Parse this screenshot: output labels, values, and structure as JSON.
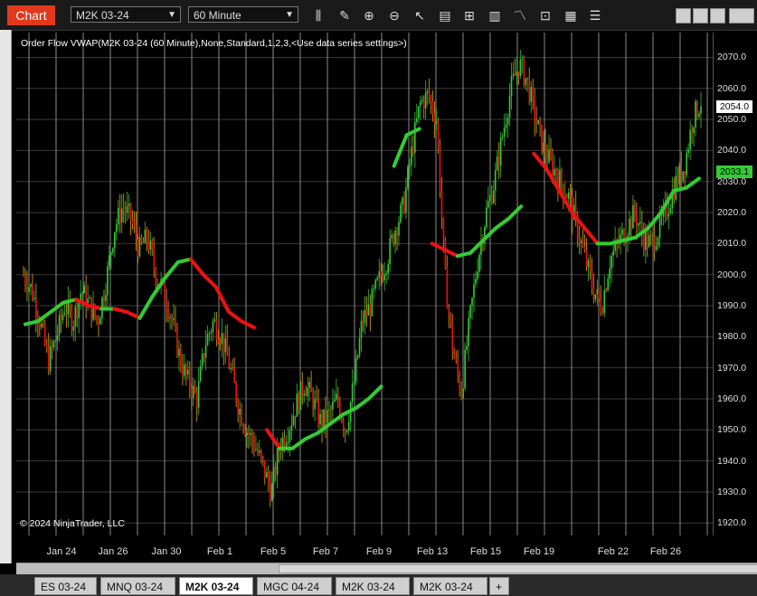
{
  "toolbar": {
    "chart_label": "Chart",
    "instrument": "M2K 03-24",
    "interval": "60 Minute",
    "tools": [
      "bars-icon",
      "pencil-icon",
      "zoom-in-icon",
      "zoom-out-icon",
      "pointer-icon",
      "data-box-icon",
      "properties-icon",
      "strategy-icon",
      "indicator-icon",
      "drawing-icon",
      "template-icon",
      "more-icon"
    ]
  },
  "indicator_label": "Order Flow VWAP(M2K 03-24 (60 Minute),None,Standard,1,2,3,<Use data series settings>)",
  "copyright": "© 2024 NinjaTrader, LLC",
  "colors": {
    "up": "#33cc33",
    "down": "#ee1111",
    "accent": "#e0391c",
    "grid": "#555555"
  },
  "chart_data": {
    "type": "candlestick",
    "x_tick_labels": [
      "Jan 24",
      "Jan 26",
      "Jan 30",
      "Feb 1",
      "Feb 5",
      "Feb 7",
      "Feb 9",
      "Feb 13",
      "Feb 15",
      "Feb 19",
      "Feb 22",
      "Feb 26"
    ],
    "y_ticks": [
      1920.0,
      1930.0,
      1940.0,
      1950.0,
      1960.0,
      1970.0,
      1980.0,
      1990.0,
      2000.0,
      2010.0,
      2020.0,
      2030.0,
      2040.0,
      2050.0,
      2060.0,
      2070.0
    ],
    "ylim": [
      1916,
      2078
    ],
    "last_price": "2054.0",
    "vwap_value": "2033.1",
    "price_path": [
      2000,
      1995,
      1985,
      1972,
      1980,
      1990,
      1985,
      1995,
      1990,
      1985,
      1998,
      2015,
      2022,
      2018,
      2008,
      2012,
      2000,
      1995,
      1985,
      1972,
      1965,
      1960,
      1978,
      1985,
      1980,
      1970,
      1958,
      1950,
      1945,
      1938,
      1930,
      1945,
      1950,
      1958,
      1965,
      1960,
      1952,
      1955,
      1960,
      1950,
      1965,
      1985,
      1990,
      1998,
      2005,
      2015,
      2022,
      2040,
      2055,
      2058,
      2050,
      2000,
      1975,
      1962,
      1985,
      2005,
      2020,
      2030,
      2045,
      2060,
      2068,
      2062,
      2050,
      2040,
      2035,
      2030,
      2025,
      2015,
      2005,
      1995,
      1990,
      2005,
      2010,
      2015,
      2020,
      2012,
      2010,
      2015,
      2022,
      2030,
      2035,
      2050,
      2056
    ],
    "vwap_path": [
      1984,
      1985,
      1988,
      1991,
      1992,
      1990,
      1989,
      1989,
      1988,
      1986,
      1993,
      1999,
      2004,
      2005,
      2000,
      1996,
      1988,
      1985,
      1983,
      1950,
      1944,
      1944,
      1947,
      1949,
      1952,
      1955,
      1957,
      1960,
      1964,
      2035,
      2045,
      2047,
      2010,
      2008,
      2006,
      2007,
      2011,
      2015,
      2018,
      2022,
      2039,
      2034,
      2027,
      2020,
      2015,
      2010,
      2010,
      2011,
      2012,
      2015,
      2020,
      2027,
      2028,
      2031
    ]
  },
  "tabs": [
    "ES 03-24",
    "MNQ 03-24",
    "M2K 03-24",
    "MGC 04-24",
    "M2K 03-24",
    "M2K 03-24",
    "+"
  ]
}
